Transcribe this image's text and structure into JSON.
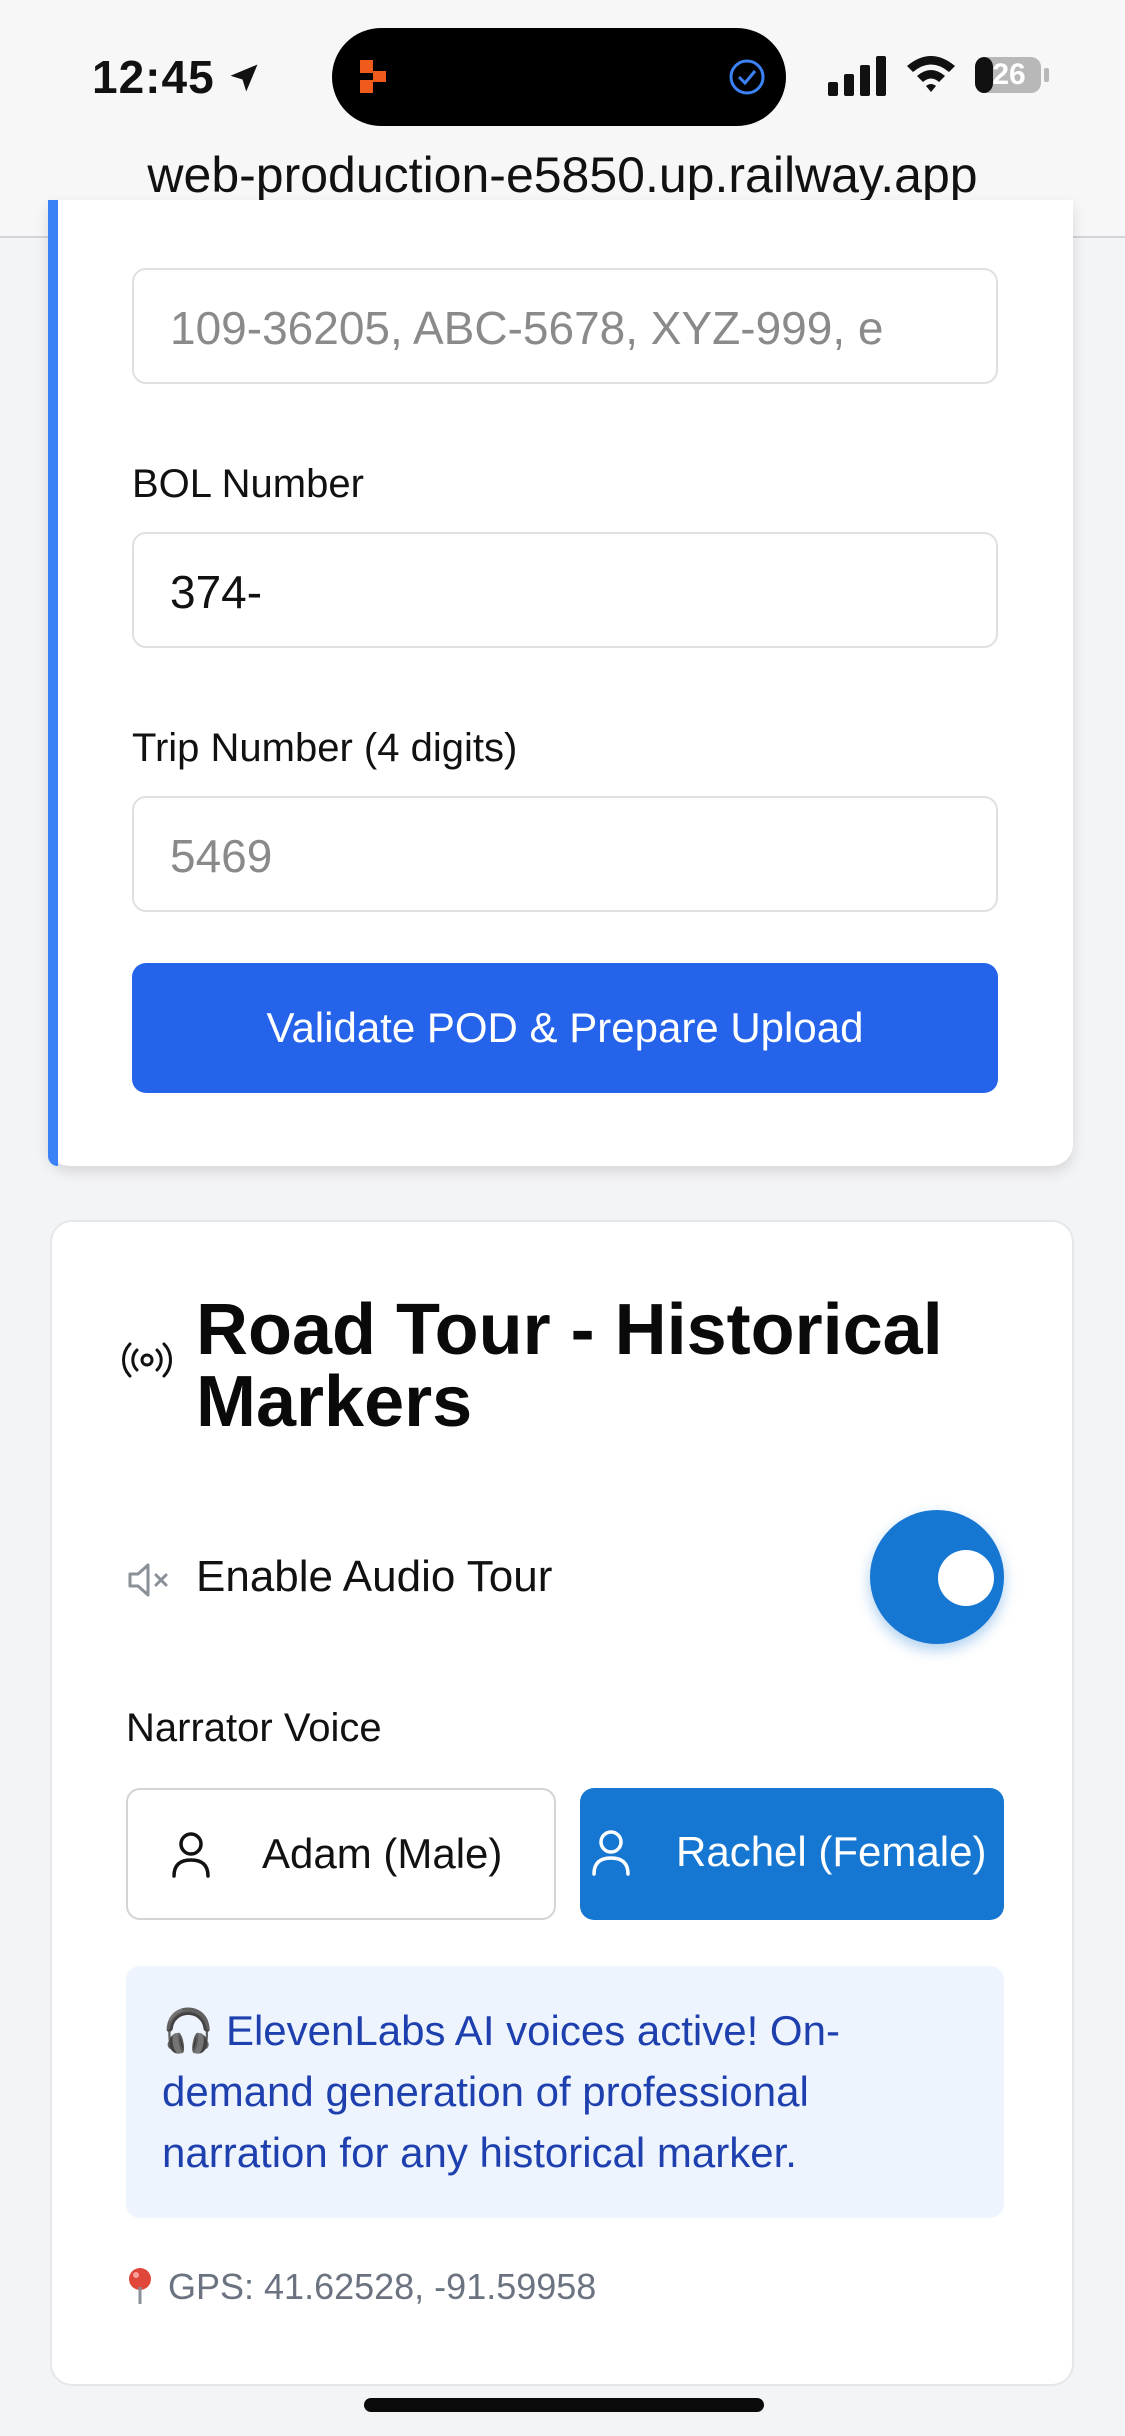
{
  "status_bar": {
    "time": "12:45",
    "battery": "26"
  },
  "browser": {
    "url": "web-production-e5850.up.railway.app"
  },
  "pod_form": {
    "trailer_field": {
      "value": "",
      "placeholder": "109-36205, ABC-5678, XYZ-999, e"
    },
    "bol_label": "BOL Number",
    "bol_field": {
      "value": "374-",
      "placeholder": ""
    },
    "trip_label": "Trip Number (4 digits)",
    "trip_field": {
      "value": "",
      "placeholder": "5469"
    },
    "submit_label": "Validate POD & Prepare Upload"
  },
  "road_tour": {
    "title": "Road Tour - Historical Markers",
    "audio_label": "Enable Audio Tour",
    "audio_enabled": true,
    "narrator_label": "Narrator Voice",
    "voices": [
      {
        "label": "Adam (Male)",
        "selected": false
      },
      {
        "label": "Rachel (Female)",
        "selected": true
      }
    ],
    "info_text": "🎧 ElevenLabs AI voices active! On-demand generation of professional narration for any historical marker.",
    "gps_text": "GPS: 41.62528, -91.59958"
  },
  "colors": {
    "accent": "#2563eb",
    "toggle": "#1677d2",
    "card_accent": "#3b82f6",
    "info_bg": "#eef4fe",
    "info_text": "#1e40af"
  }
}
